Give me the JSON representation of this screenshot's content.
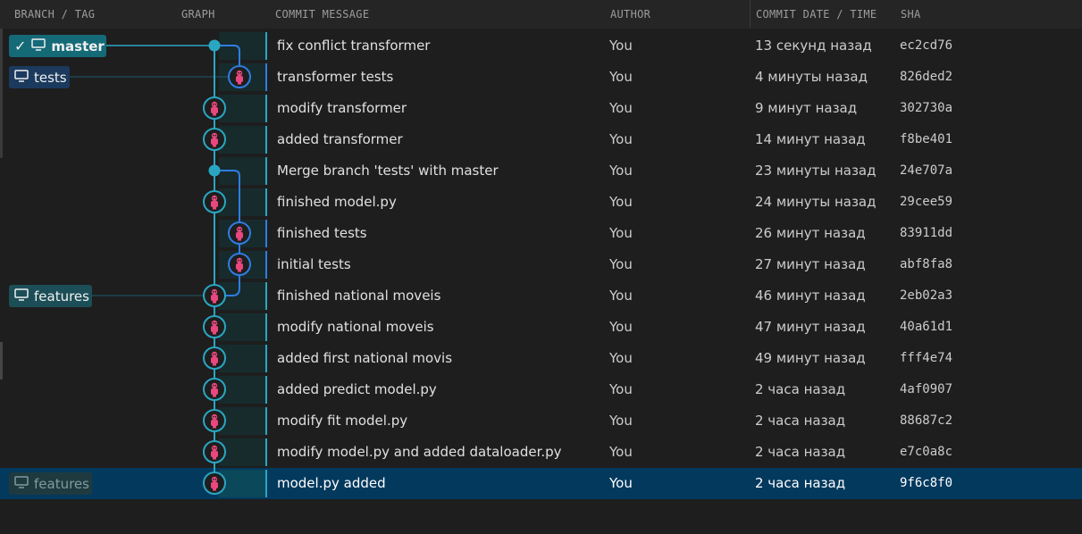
{
  "headers": {
    "branch_tag": "BRANCH / TAG",
    "graph": "GRAPH",
    "commit_message": "COMMIT MESSAGE",
    "author": "AUTHOR",
    "commit_date_time": "COMMIT DATE / TIME",
    "sha": "SHA"
  },
  "branches": {
    "master": "master",
    "tests": "tests",
    "features": "features",
    "features_remote": "features"
  },
  "commits": [
    {
      "message": "fix conflict transformer",
      "author": "You",
      "date": "13 секунд назад",
      "sha": "ec2cd76"
    },
    {
      "message": "transformer tests",
      "author": "You",
      "date": "4 минуты назад",
      "sha": "826ded2"
    },
    {
      "message": "modify transformer",
      "author": "You",
      "date": "9 минут назад",
      "sha": "302730a"
    },
    {
      "message": "added transformer",
      "author": "You",
      "date": "14 минут назад",
      "sha": "f8be401"
    },
    {
      "message": "Merge branch 'tests' with master",
      "author": "You",
      "date": "23 минуты назад",
      "sha": "24e707a"
    },
    {
      "message": "finished model.py",
      "author": "You",
      "date": "24 минуты назад",
      "sha": "29cee59"
    },
    {
      "message": "finished tests",
      "author": "You",
      "date": "26 минут назад",
      "sha": "83911dd"
    },
    {
      "message": "initial tests",
      "author": "You",
      "date": "27 минут назад",
      "sha": "abf8fa8"
    },
    {
      "message": "finished national moveis",
      "author": "You",
      "date": "46 минут назад",
      "sha": "2eb02a3"
    },
    {
      "message": "modify national moveis",
      "author": "You",
      "date": "47 минут назад",
      "sha": "40a61d1"
    },
    {
      "message": "added first national movis",
      "author": "You",
      "date": "49 минут назад",
      "sha": "fff4e74"
    },
    {
      "message": "added predict model.py",
      "author": "You",
      "date": "2 часа назад",
      "sha": "4af0907"
    },
    {
      "message": "modify fit model.py",
      "author": "You",
      "date": "2 часа назад",
      "sha": "88687c2"
    },
    {
      "message": "modify model.py and added dataloader.py",
      "author": "You",
      "date": "2 часа назад",
      "sha": "e7c0a8c"
    },
    {
      "message": "model.py added",
      "author": "You",
      "date": "2 часа назад",
      "sha": "9f6c8f0"
    }
  ],
  "selected_index": 14,
  "colors": {
    "main_lane": "#2aa6c2",
    "branch_lane": "#2f7de1",
    "avatar": "#e8487e",
    "selected_row": "#04395e"
  },
  "icons": {
    "branch_icon": "monitor-icon",
    "current_branch": "check-icon",
    "commit_node": "avatar-icon",
    "merge_node": "dot-icon"
  }
}
